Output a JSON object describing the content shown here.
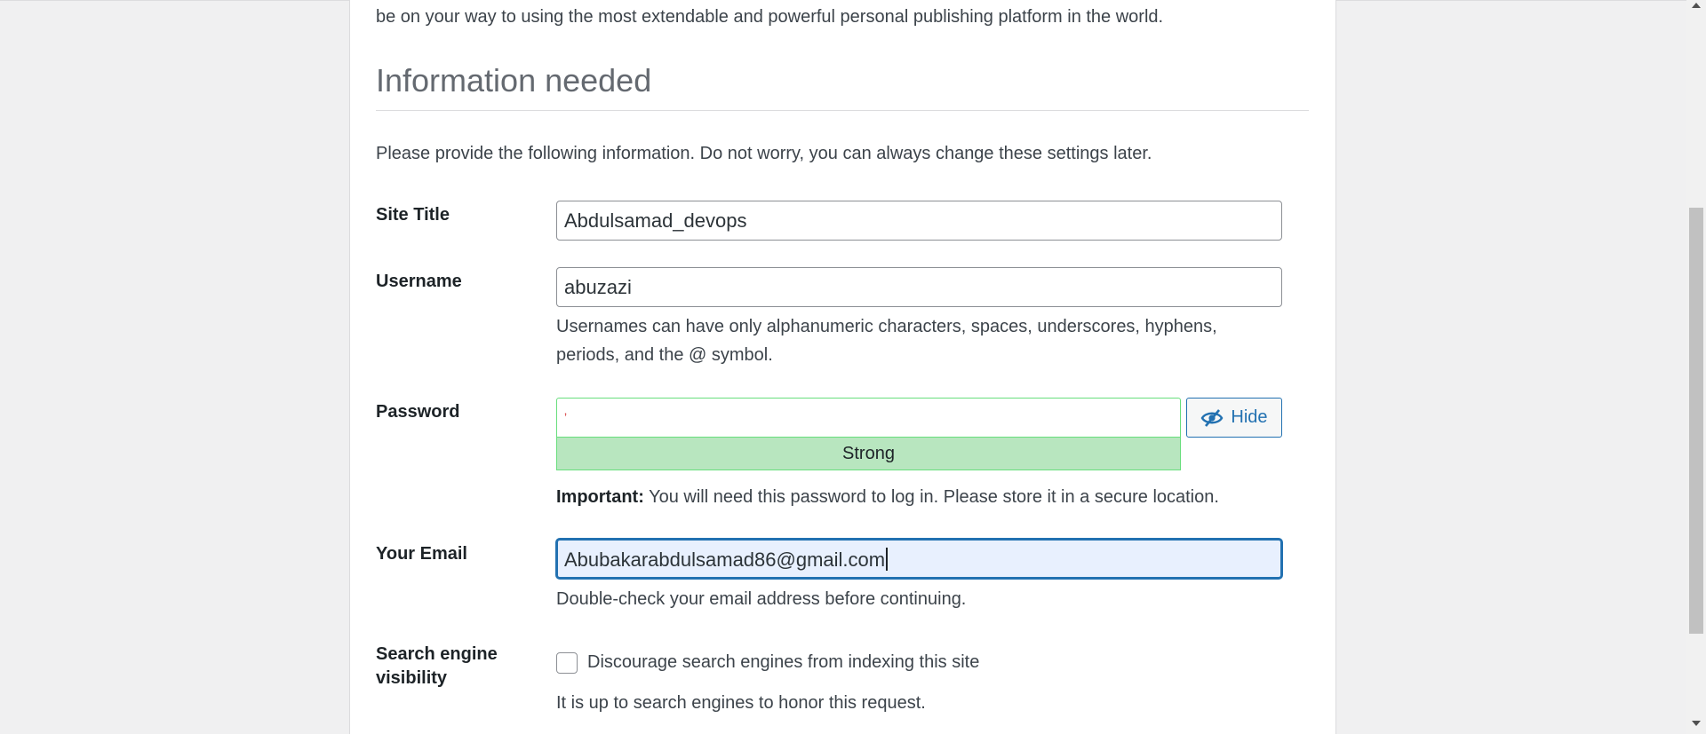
{
  "intro_text": "be on your way to using the most extendable and powerful personal publishing platform in the world.",
  "section_heading": "Information needed",
  "description": "Please provide the following information. Do not worry, you can always change these settings later.",
  "site_title": {
    "label": "Site Title",
    "value": "Abdulsamad_devops"
  },
  "username": {
    "label": "Username",
    "value": "abuzazi",
    "hint_line1": "Usernames can have only alphanumeric characters, spaces, underscores, hyphens,",
    "hint_line2": "periods, and the @ symbol."
  },
  "password": {
    "label": "Password",
    "value": "ʼ",
    "hide_label": "Hide",
    "strength": "Strong",
    "important_label": "Important:",
    "important_text": " You will need this password to log in. Please store it in a secure location."
  },
  "email": {
    "label": "Your Email",
    "value": "Abubakarabdulsamad86@gmail.com",
    "hint": "Double-check your email address before continuing."
  },
  "search_visibility": {
    "label_line1": "Search engine",
    "label_line2": "visibility",
    "checkbox_label": "Discourage search engines from indexing this site",
    "checked": false,
    "hint": "It is up to search engines to honor this request."
  },
  "colors": {
    "accent": "#2271b1",
    "strong_bg": "#b8e6bf",
    "strong_border": "#68de7c"
  },
  "icons": {
    "hide": "eye-slash-icon"
  }
}
